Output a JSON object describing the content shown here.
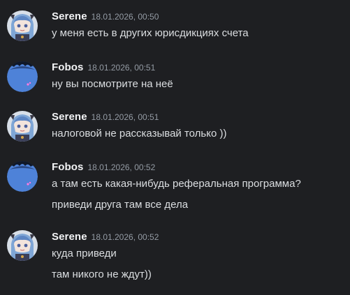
{
  "messages": [
    {
      "author": "Serene",
      "timestamp": "18.01.2026, 00:50",
      "avatar_icon": "anime-girl-avatar-icon",
      "lines": [
        "у меня есть в других юрисдикциях счета"
      ]
    },
    {
      "author": "Fobos",
      "timestamp": "18.01.2026, 00:51",
      "avatar_icon": "blue-sphere-avatar-icon",
      "lines": [
        "ну вы посмотрите на неё"
      ]
    },
    {
      "author": "Serene",
      "timestamp": "18.01.2026, 00:51",
      "avatar_icon": "anime-girl-avatar-icon",
      "lines": [
        "налоговой не рассказывай только ))"
      ]
    },
    {
      "author": "Fobos",
      "timestamp": "18.01.2026, 00:52",
      "avatar_icon": "blue-sphere-avatar-icon",
      "lines": [
        "а там есть какая-нибудь реферальная программа?",
        "приведи друга там все дела"
      ]
    },
    {
      "author": "Serene",
      "timestamp": "18.01.2026, 00:52",
      "avatar_icon": "anime-girl-avatar-icon",
      "lines": [
        "куда приведи",
        "там никого не ждут))"
      ]
    }
  ],
  "colors": {
    "background": "#1e1f22",
    "username": "#f2f3f5",
    "timestamp": "#949ba4",
    "text": "#dbdee1"
  }
}
